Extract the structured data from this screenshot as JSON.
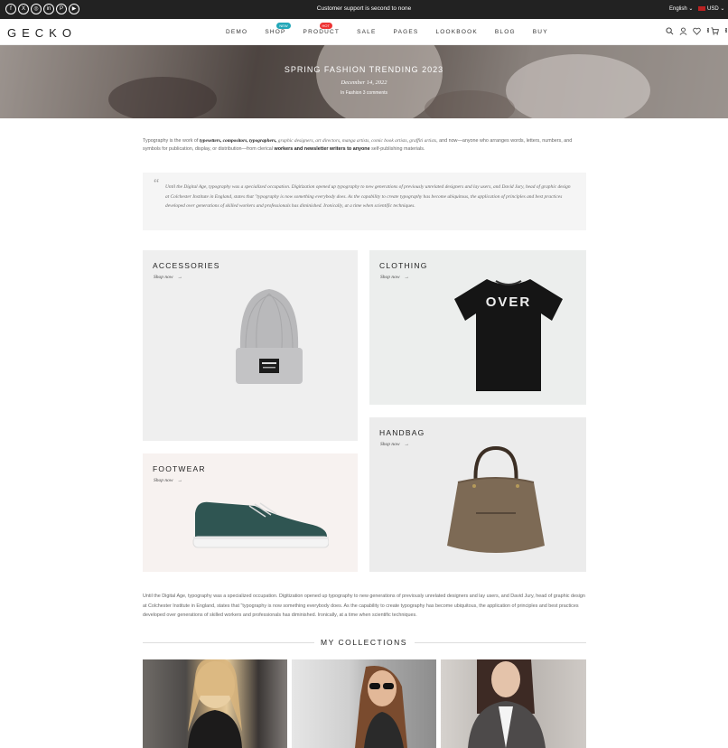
{
  "topbar": {
    "social": [
      "f",
      "X",
      "◎",
      "in",
      "P",
      "▶"
    ],
    "message": "Customer support is second to none",
    "language": "English",
    "currency": "USD"
  },
  "nav": {
    "logo": "GECKO",
    "items": [
      "DEMO",
      "SHOP",
      "PRODUCT",
      "SALE",
      "PAGES",
      "LOOKBOOK",
      "BLOG",
      "BUY"
    ],
    "badges": {
      "shop": "NEW",
      "product": "HOT"
    },
    "wishlist_count": "0",
    "cart_count": "0"
  },
  "hero": {
    "title": "SPRING FASHION TRENDING 2023",
    "date": "December 14, 2022",
    "meta": "In Fashion 3 comments"
  },
  "article": {
    "intro_1": "Typography is the work of ",
    "intro_bold_italic": "typesetters, compositors, typographers,",
    "intro_italic": " graphic designers, art directors, manga artists, comic book artists, graffiti artists",
    "intro_2": ", and now—anyone who arranges words, letters, numbers, and symbols for publication, display, or distribution—from clerical ",
    "intro_bold": "workers and newsletter writers to anyone",
    "intro_3": " self-publishing materials.",
    "quote": "Until the Digital Age, typography was a specialized occupation. Digitization opened up typography to new generations of previously unrelated designers and lay users, and David Jury, head of graphic design at Colchester Institute in England, states that \"typography is now something everybody does. As the capability to create typography has become ubiquitous, the application of principles and best practices developed over generations of skilled workers and professionals has diminished. Ironically, at a time when scientific techniques.",
    "paragraph": "Until the Digital Age, typography was a specialized occupation. Digitization opened up typography to new generations of previously unrelated designers and lay users, and David Jury, head of graphic design at Colchester Institute in England, states that \"typography is now something everybody does. As the capability to create typography has become ubiquitous, the application of principles and best practices developed over generations of skilled workers and professionals has diminished. Ironically, at a time when scientific techniques."
  },
  "categories": {
    "accessories": "ACCESSORIES",
    "clothing": "CLOTHING",
    "footwear": "FOOTWEAR",
    "handbag": "HANDBAG",
    "shop_now": "Shop now",
    "arrow": "→",
    "tshirt_print": "OVER"
  },
  "collections": {
    "title": "MY COLLECTIONS"
  },
  "colors": {
    "new_badge": "#22a7b8",
    "hot_badge": "#e33333",
    "topbar": "#222222"
  }
}
